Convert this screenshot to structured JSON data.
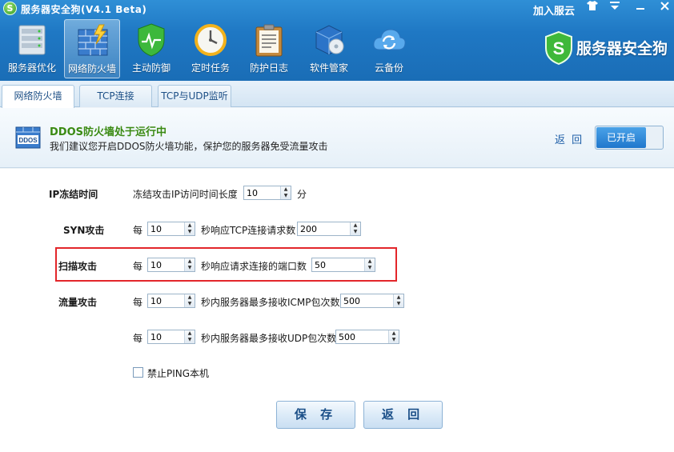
{
  "titlebar": {
    "title": "服务器安全狗(V4.1 Beta)",
    "join_cloud": "加入服云"
  },
  "toolbar": {
    "items": [
      {
        "label": "服务器优化",
        "icon": "server-optimize-icon"
      },
      {
        "label": "网络防火墙",
        "icon": "firewall-icon"
      },
      {
        "label": "主动防御",
        "icon": "shield-icon"
      },
      {
        "label": "定时任务",
        "icon": "clock-icon"
      },
      {
        "label": "防护日志",
        "icon": "log-icon"
      },
      {
        "label": "软件管家",
        "icon": "software-icon"
      },
      {
        "label": "云备份",
        "icon": "cloud-backup-icon"
      }
    ],
    "active_index": 1
  },
  "brand": {
    "text": "服务器安全狗"
  },
  "tabs": [
    {
      "label": "网络防火墙"
    },
    {
      "label": "TCP连接"
    },
    {
      "label": "TCP与UDP监听"
    }
  ],
  "status": {
    "icon_label": "DDOS",
    "title": "DDOS防火墙处于运行中",
    "description": "我们建议您开启DDOS防火墙功能，保护您的服务器免受流量攻击",
    "back_link": "返 回",
    "toggle_label": "已开启"
  },
  "form": {
    "ip_freeze": {
      "label": "IP冻结时间",
      "text": "冻结攻击IP访问时间长度",
      "value": "10",
      "unit": "分"
    },
    "syn": {
      "label": "SYN攻击",
      "prefix": "每",
      "value1": "10",
      "text": "秒响应TCP连接请求数",
      "value2": "200"
    },
    "scan": {
      "label": "扫描攻击",
      "prefix": "每",
      "value1": "10",
      "text": "秒响应请求连接的端口数",
      "value2": "50"
    },
    "flow": {
      "label": "流量攻击",
      "prefix": "每",
      "value1": "10",
      "text": "秒内服务器最多接收ICMP包次数",
      "value2": "500"
    },
    "udp": {
      "prefix": "每",
      "value1": "10",
      "text": "秒内服务器最多接收UDP包次数",
      "value2": "500"
    },
    "ping": {
      "label": "禁止PING本机",
      "checked": false
    }
  },
  "buttons": {
    "save": "保 存",
    "back": "返 回"
  }
}
